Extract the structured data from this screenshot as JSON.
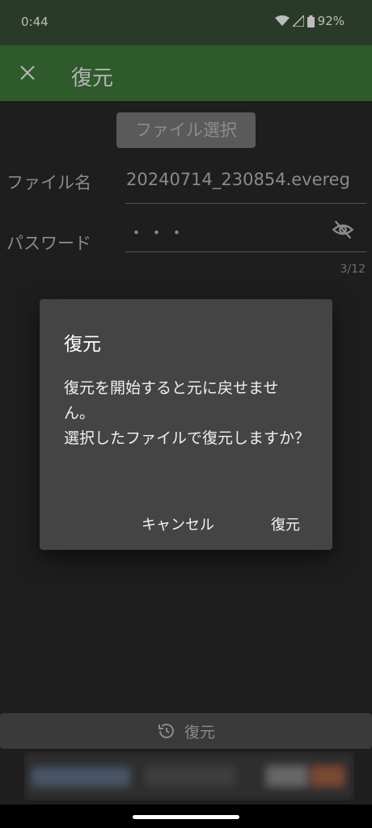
{
  "status_bar": {
    "time": "0:44",
    "battery": "92%"
  },
  "app_bar": {
    "title": "復元"
  },
  "form": {
    "file_select_label": "ファイル選択",
    "file_name_label": "ファイル名",
    "file_name_value": "20240714_230854.evereg",
    "password_label": "パスワード",
    "password_value": "・・・",
    "password_counter": "3/12"
  },
  "dialog": {
    "title": "復元",
    "message": "復元を開始すると元に戻せませ\nん。\n選択したファイルで復元しますか？",
    "cancel_label": "キャンセル",
    "confirm_label": "復元"
  },
  "bottom": {
    "restore_label": "復元"
  },
  "colors": {
    "app_bar": "#2e5a2c",
    "dialog": "#444444"
  }
}
